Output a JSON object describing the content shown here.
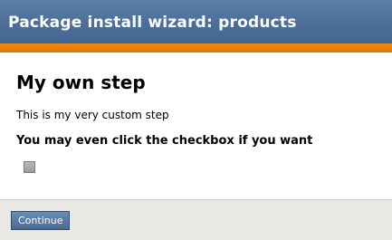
{
  "header": {
    "title": "Package install wizard: products"
  },
  "step": {
    "heading": "My own step",
    "description": "This is my very custom step",
    "checkbox_label": "You may even click the checkbox if you want",
    "checkbox_checked": false
  },
  "footer": {
    "continue_label": "Continue"
  },
  "colors": {
    "header_bg": "#4c6f9a",
    "accent_rule": "#e07200",
    "footer_bg": "#e8e8e4",
    "button_bg": "#4a6b95"
  }
}
